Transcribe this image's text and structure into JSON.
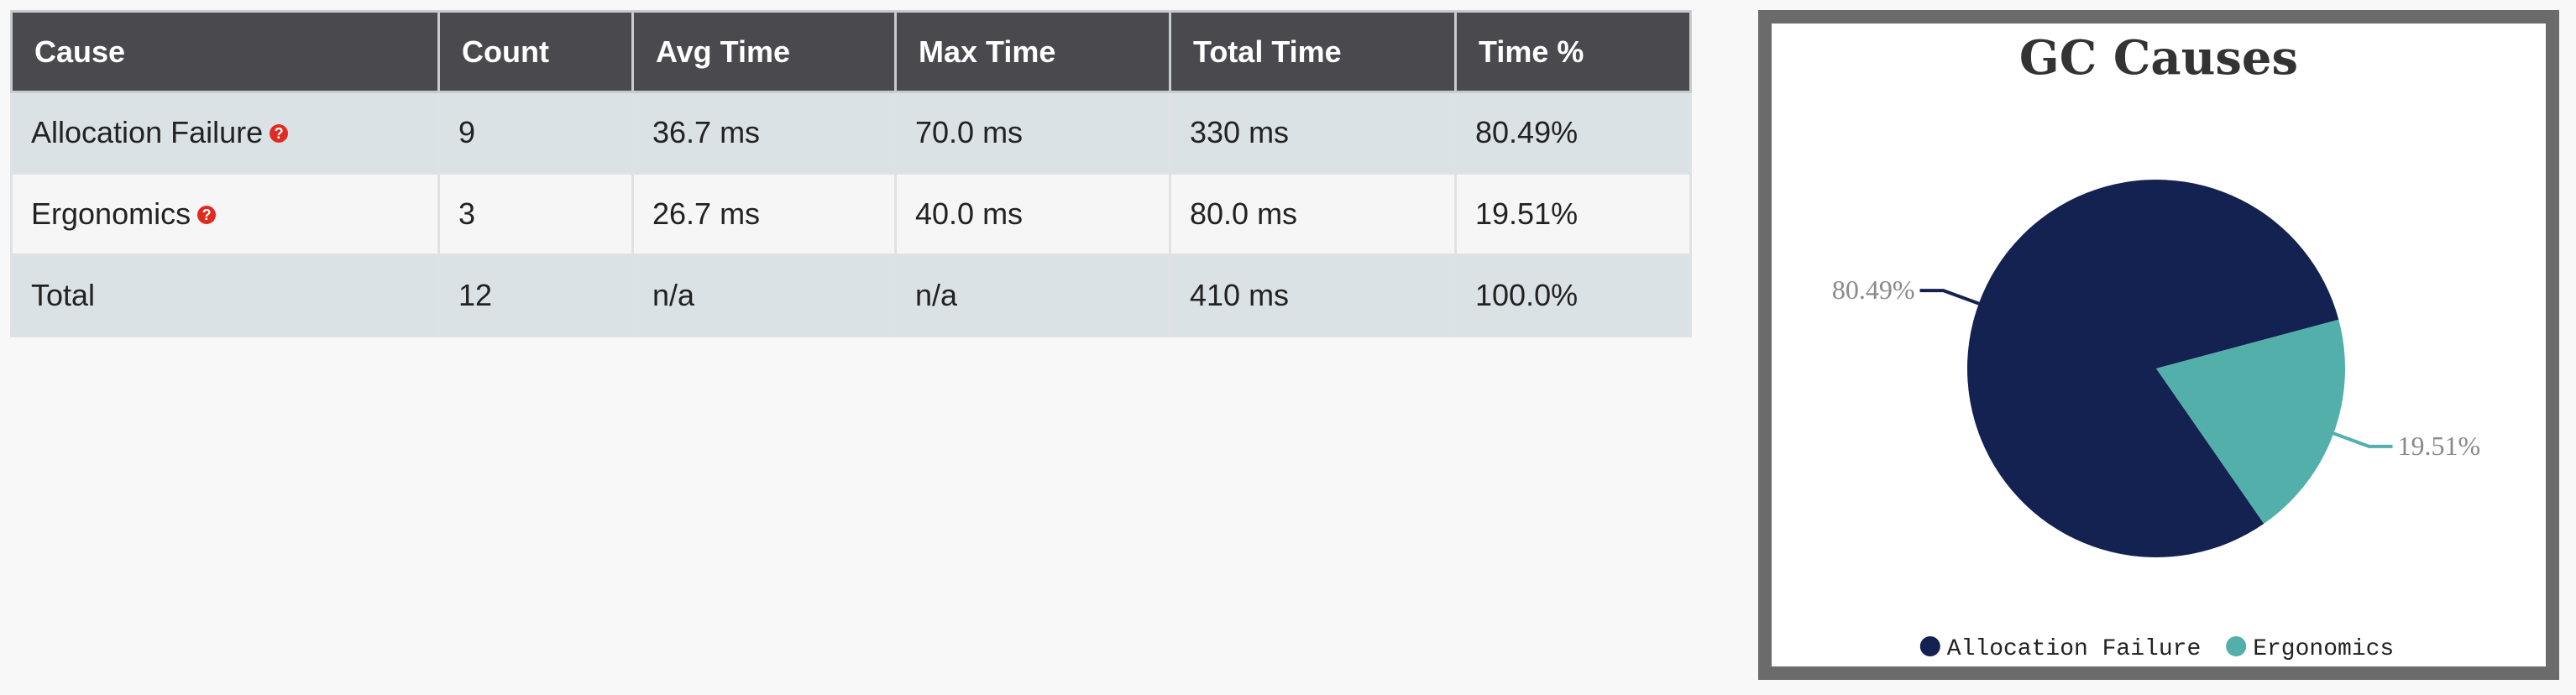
{
  "table": {
    "headers": [
      "Cause",
      "Count",
      "Avg Time",
      "Max Time",
      "Total Time",
      "Time %"
    ],
    "rows": [
      {
        "cause": "Allocation Failure",
        "count": "9",
        "avg_time": "36.7 ms",
        "max_time": "70.0 ms",
        "total_time": "330 ms",
        "time_pct": "80.49%",
        "help_icon": "question-circle-icon"
      },
      {
        "cause": "Ergonomics",
        "count": "3",
        "avg_time": "26.7 ms",
        "max_time": "40.0 ms",
        "total_time": "80.0 ms",
        "time_pct": "19.51%",
        "help_icon": "question-circle-icon"
      },
      {
        "cause": "Total",
        "count": "12",
        "avg_time": "n/a",
        "max_time": "n/a",
        "total_time": "410 ms",
        "time_pct": "100.0%"
      }
    ],
    "help_icon_glyph": "?",
    "colors": {
      "header_bg": "#4a4a4e",
      "help_icon": "#e12b20"
    }
  },
  "chart_data": {
    "type": "pie",
    "title": "GC Causes",
    "categories": [
      "Allocation Failure",
      "Ergonomics"
    ],
    "values": [
      80.49,
      19.51
    ],
    "labels": [
      "80.49%",
      "19.51%"
    ],
    "colors": [
      "#132250",
      "#52afa9"
    ],
    "legend": "bottom"
  }
}
